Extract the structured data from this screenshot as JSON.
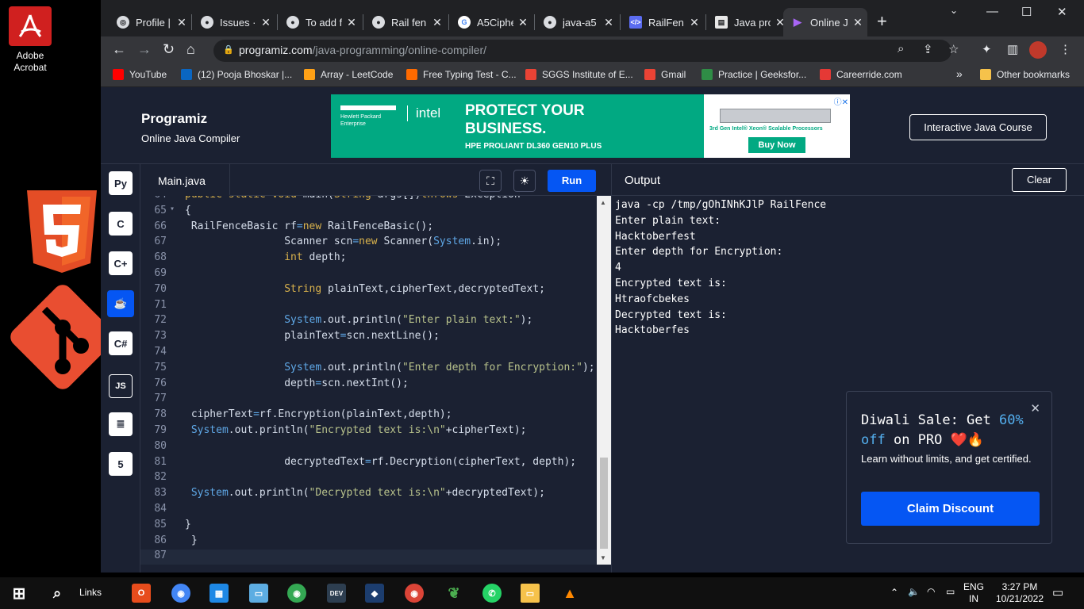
{
  "desktop": {
    "acrobat_label": "Adobe Acrobat"
  },
  "browser": {
    "tabs": [
      {
        "title": "Profile |",
        "icon": "github-icon"
      },
      {
        "title": "Issues ·",
        "icon": "github-icon"
      },
      {
        "title": "To add f",
        "icon": "github-icon"
      },
      {
        "title": "Rail fen",
        "icon": "github-icon"
      },
      {
        "title": "A5Ciphe",
        "icon": "google-icon"
      },
      {
        "title": "java-a5",
        "icon": "github-icon"
      },
      {
        "title": "RailFen",
        "icon": "code-icon"
      },
      {
        "title": "Java pro",
        "icon": "page-icon"
      },
      {
        "title": "Online J",
        "icon": "programiz-icon",
        "active": true
      }
    ],
    "url_domain": "programiz.com",
    "url_path": "/java-programming/online-compiler/",
    "bookmarks": [
      {
        "label": "YouTube",
        "color": "#ff0000"
      },
      {
        "label": "(12) Pooja Bhoskar |...",
        "color": "#0a66c2"
      },
      {
        "label": "Array - LeetCode",
        "color": "#ffa116"
      },
      {
        "label": "Free Typing Test - C...",
        "color": "#ff6a00"
      },
      {
        "label": "SGGS Institute of E...",
        "color": "#ea4335"
      },
      {
        "label": "Gmail",
        "color": "#ea4335"
      },
      {
        "label": "Practice | Geeksfor...",
        "color": "#2f8d46"
      },
      {
        "label": "Careerride.com",
        "color": "#e53935"
      }
    ],
    "more_bookmarks": "»",
    "other_bookmarks": "Other bookmarks"
  },
  "site": {
    "logo": "Programiz",
    "subtitle": "Online Java Compiler",
    "course_button": "Interactive Java Course",
    "ad": {
      "hpe": "Hewlett Packard Enterprise",
      "intel": "intel",
      "headline": "PROTECT YOUR BUSINESS.",
      "product": "HPE PROLIANT DL360 GEN10 PLUS",
      "processor": "3rd Gen Intel® Xeon® Scalable Processors",
      "buy": "Buy Now"
    },
    "languages": [
      "python",
      "c",
      "cpp",
      "java",
      "csharp",
      "JS",
      "sql",
      "html"
    ],
    "active_language": "java",
    "editor": {
      "file_tab": "Main.java",
      "run_label": "Run",
      "lines": [
        {
          "n": "64",
          "text": "  public static void main(String args[])throws Exception"
        },
        {
          "n": "65",
          "text": "  {",
          "fold": true
        },
        {
          "n": "66",
          "text": "   RailFenceBasic rf=new RailFenceBasic();"
        },
        {
          "n": "67",
          "text": "                  Scanner scn=new Scanner(System.in);"
        },
        {
          "n": "68",
          "text": "                  int depth;"
        },
        {
          "n": "69",
          "text": ""
        },
        {
          "n": "70",
          "text": "                  String plainText,cipherText,decryptedText;"
        },
        {
          "n": "71",
          "text": ""
        },
        {
          "n": "72",
          "text": "                  System.out.println(\"Enter plain text:\");"
        },
        {
          "n": "73",
          "text": "                  plainText=scn.nextLine();"
        },
        {
          "n": "74",
          "text": ""
        },
        {
          "n": "75",
          "text": "                  System.out.println(\"Enter depth for Encryption:\");"
        },
        {
          "n": "76",
          "text": "                  depth=scn.nextInt();"
        },
        {
          "n": "77",
          "text": ""
        },
        {
          "n": "78",
          "text": "   cipherText=rf.Encryption(plainText,depth);"
        },
        {
          "n": "79",
          "text": "   System.out.println(\"Encrypted text is:\\n\"+cipherText);"
        },
        {
          "n": "80",
          "text": ""
        },
        {
          "n": "81",
          "text": "                  decryptedText=rf.Decryption(cipherText, depth);"
        },
        {
          "n": "82",
          "text": ""
        },
        {
          "n": "83",
          "text": "   System.out.println(\"Decrypted text is:\\n\"+decryptedText);"
        },
        {
          "n": "84",
          "text": ""
        },
        {
          "n": "85",
          "text": "  }"
        },
        {
          "n": "86",
          "text": " }"
        },
        {
          "n": "87",
          "text": ""
        }
      ]
    },
    "output": {
      "title": "Output",
      "clear_label": "Clear",
      "lines": [
        "java -cp /tmp/gOhINhKJlP RailFence",
        "Enter plain text:",
        "Hacktoberfest",
        "Enter depth for Encryption:",
        "4",
        "Encrypted text is:",
        "Htraofcbekes",
        "Decrypted text is:",
        "Hacktoberfes"
      ]
    },
    "promo": {
      "title_pre": "Diwali Sale: Get ",
      "title_highlight": "60% off",
      "title_post": " on PRO ❤️🔥",
      "subtitle": "Learn without limits, and get certified.",
      "button": "Claim Discount"
    }
  },
  "taskbar": {
    "search_label": "Links",
    "lang": "ENG",
    "region": "IN",
    "time": "3:27 PM",
    "date": "10/21/2022"
  }
}
